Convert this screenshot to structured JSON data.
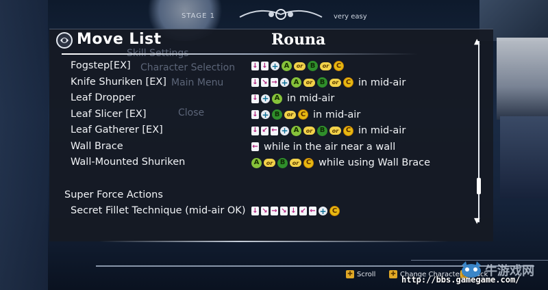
{
  "background": {
    "stage_label": "STAGE 1",
    "difficulty": "very easy",
    "ghost_menu": [
      "Skill Settings",
      "Character Selection",
      "Main Menu",
      "Close"
    ]
  },
  "panel": {
    "title": "Move List",
    "character": "Rouna",
    "moves": [
      {
        "name": "Fogstep[EX]",
        "command": [
          [
            "arrow",
            "down"
          ],
          [
            "arrow",
            "down"
          ],
          [
            "plus"
          ],
          [
            "btn",
            "A"
          ],
          [
            "or"
          ],
          [
            "btn",
            "B"
          ],
          [
            "or"
          ],
          [
            "btn",
            "C"
          ]
        ],
        "suffix": ""
      },
      {
        "name": "Knife Shuriken [EX]",
        "command": [
          [
            "arrow",
            "down"
          ],
          [
            "arrow",
            "down-right"
          ],
          [
            "arrow",
            "right"
          ],
          [
            "plus"
          ],
          [
            "btn",
            "A"
          ],
          [
            "or"
          ],
          [
            "btn",
            "B"
          ],
          [
            "or"
          ],
          [
            "btn",
            "C"
          ]
        ],
        "suffix": "in mid-air"
      },
      {
        "name": "Leaf Dropper",
        "command": [
          [
            "arrow",
            "down"
          ],
          [
            "plus"
          ],
          [
            "btn",
            "A"
          ]
        ],
        "suffix": "in mid-air"
      },
      {
        "name": "Leaf Slicer [EX]",
        "command": [
          [
            "arrow",
            "down"
          ],
          [
            "plus"
          ],
          [
            "btn",
            "B"
          ],
          [
            "or"
          ],
          [
            "btn",
            "C"
          ]
        ],
        "suffix": "in mid-air"
      },
      {
        "name": "Leaf Gatherer [EX]",
        "command": [
          [
            "arrow",
            "down"
          ],
          [
            "arrow",
            "down-left"
          ],
          [
            "arrow",
            "left"
          ],
          [
            "plus"
          ],
          [
            "btn",
            "A"
          ],
          [
            "or"
          ],
          [
            "btn",
            "B"
          ],
          [
            "or"
          ],
          [
            "btn",
            "C"
          ]
        ],
        "suffix": "in mid-air"
      },
      {
        "name": "Wall Brace",
        "command": [
          [
            "arrow",
            "left"
          ]
        ],
        "suffix": "while in the air near a wall"
      },
      {
        "name": "Wall-Mounted Shuriken",
        "command": [
          [
            "btn",
            "A"
          ],
          [
            "or"
          ],
          [
            "btn",
            "B"
          ],
          [
            "or"
          ],
          [
            "btn",
            "C"
          ]
        ],
        "suffix": "while using Wall Brace"
      }
    ],
    "section_heading": "Super Force Actions",
    "super_moves": [
      {
        "name": "Secret Fillet Technique (mid-air OK)",
        "command": [
          [
            "arrow",
            "down"
          ],
          [
            "arrow",
            "down-right"
          ],
          [
            "arrow",
            "right"
          ],
          [
            "arrow",
            "down-right"
          ],
          [
            "arrow",
            "down"
          ],
          [
            "arrow",
            "down-left"
          ],
          [
            "arrow",
            "left"
          ],
          [
            "plus"
          ],
          [
            "btn",
            "C"
          ]
        ],
        "suffix": ""
      }
    ],
    "or_label": "or"
  },
  "footer": {
    "scroll": "Scroll",
    "change_character": "Change Character",
    "back": "Back"
  },
  "watermark": {
    "text": "牛游戏网",
    "url": "http://bbs.gamegame.com/"
  },
  "colors": {
    "arrow_fg": "#b01c7a",
    "button_a": "#86c23a",
    "button_b": "#2f8f2b",
    "button_c": "#e6b812",
    "or_pill": "#f2d24a"
  }
}
